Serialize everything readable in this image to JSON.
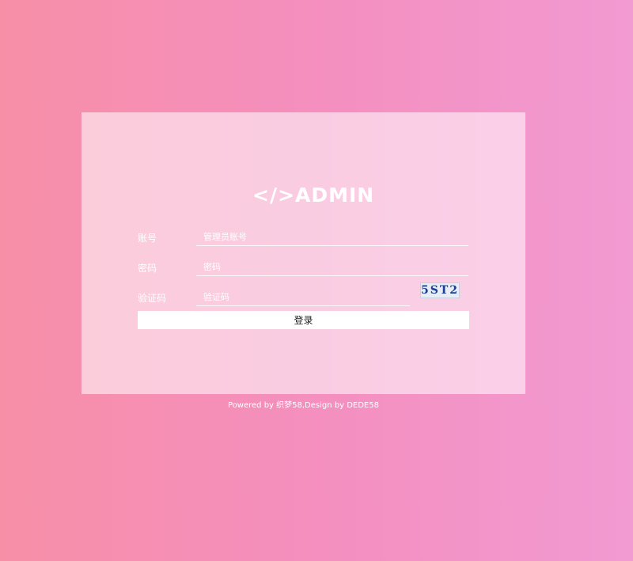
{
  "logo": {
    "text": "</>ADMIN"
  },
  "form": {
    "account": {
      "label": "账号",
      "placeholder": "管理员账号"
    },
    "password": {
      "label": "密码",
      "placeholder": "密码"
    },
    "captcha": {
      "label": "验证码",
      "placeholder": "验证码",
      "image_text": "5ST2"
    },
    "submit_label": "登录"
  },
  "footer": {
    "text": "Powered by 织梦58,Design by DEDE58"
  },
  "colors": {
    "background_left": "#f78fa7",
    "background_right": "#f29ad2",
    "text": "#ffffff"
  }
}
